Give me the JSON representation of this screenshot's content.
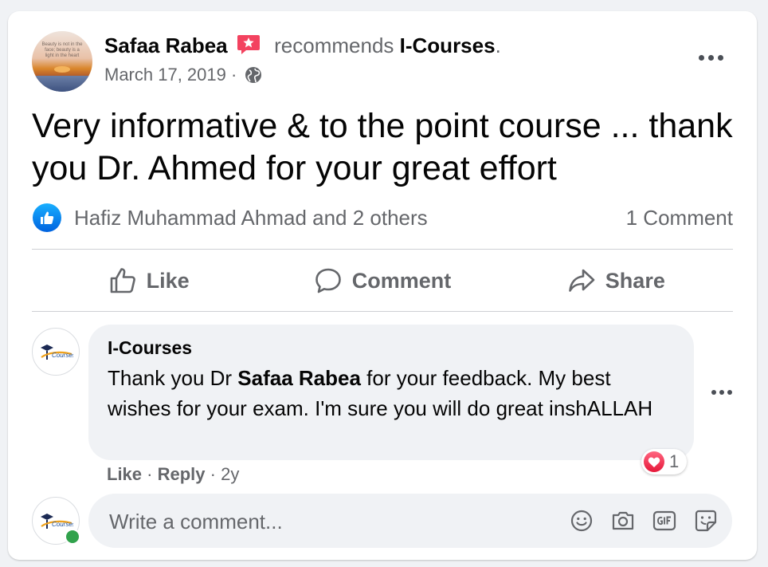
{
  "post": {
    "author": "Safaa Rabea",
    "recommends_word": "recommends",
    "page": "I-Courses",
    "period": ".",
    "date": "March 17, 2019",
    "separator": "·",
    "avatar_quote": "Beauty is not in the face; beauty is a light in the heart",
    "text": "Very informative & to the point course ... thank you Dr. Ahmed for your great effort",
    "reactions_text": "Hafiz Muhammad Ahmad and 2 others",
    "comment_count": "1 Comment"
  },
  "actions": {
    "like": "Like",
    "comment": "Comment",
    "share": "Share"
  },
  "comment": {
    "author": "I-Courses",
    "text_before": "Thank you Dr ",
    "mention": "Safaa Rabea",
    "text_after": " for your feedback. My best wishes for your exam. I'm sure you will do great inshALLAH",
    "reaction_count": "1",
    "like": "Like",
    "dot": "·",
    "reply": "Reply",
    "age": "2y",
    "logo_text": "Courses"
  },
  "composer": {
    "placeholder": "Write a comment..."
  },
  "colors": {
    "accent_blue": "#1877f2",
    "secondary_text": "#65676b",
    "heart_red": "#e61739",
    "online_green": "#31a24c"
  },
  "icons": {
    "recommend": "recommend-star-icon",
    "audience": "globe-icon",
    "more": "more-dots-icon",
    "like_reaction": "like-reaction-icon",
    "heart_reaction": "heart-reaction-icon",
    "emoji": "emoji-icon",
    "camera": "camera-icon",
    "gif": "gif-icon",
    "sticker": "sticker-icon"
  }
}
